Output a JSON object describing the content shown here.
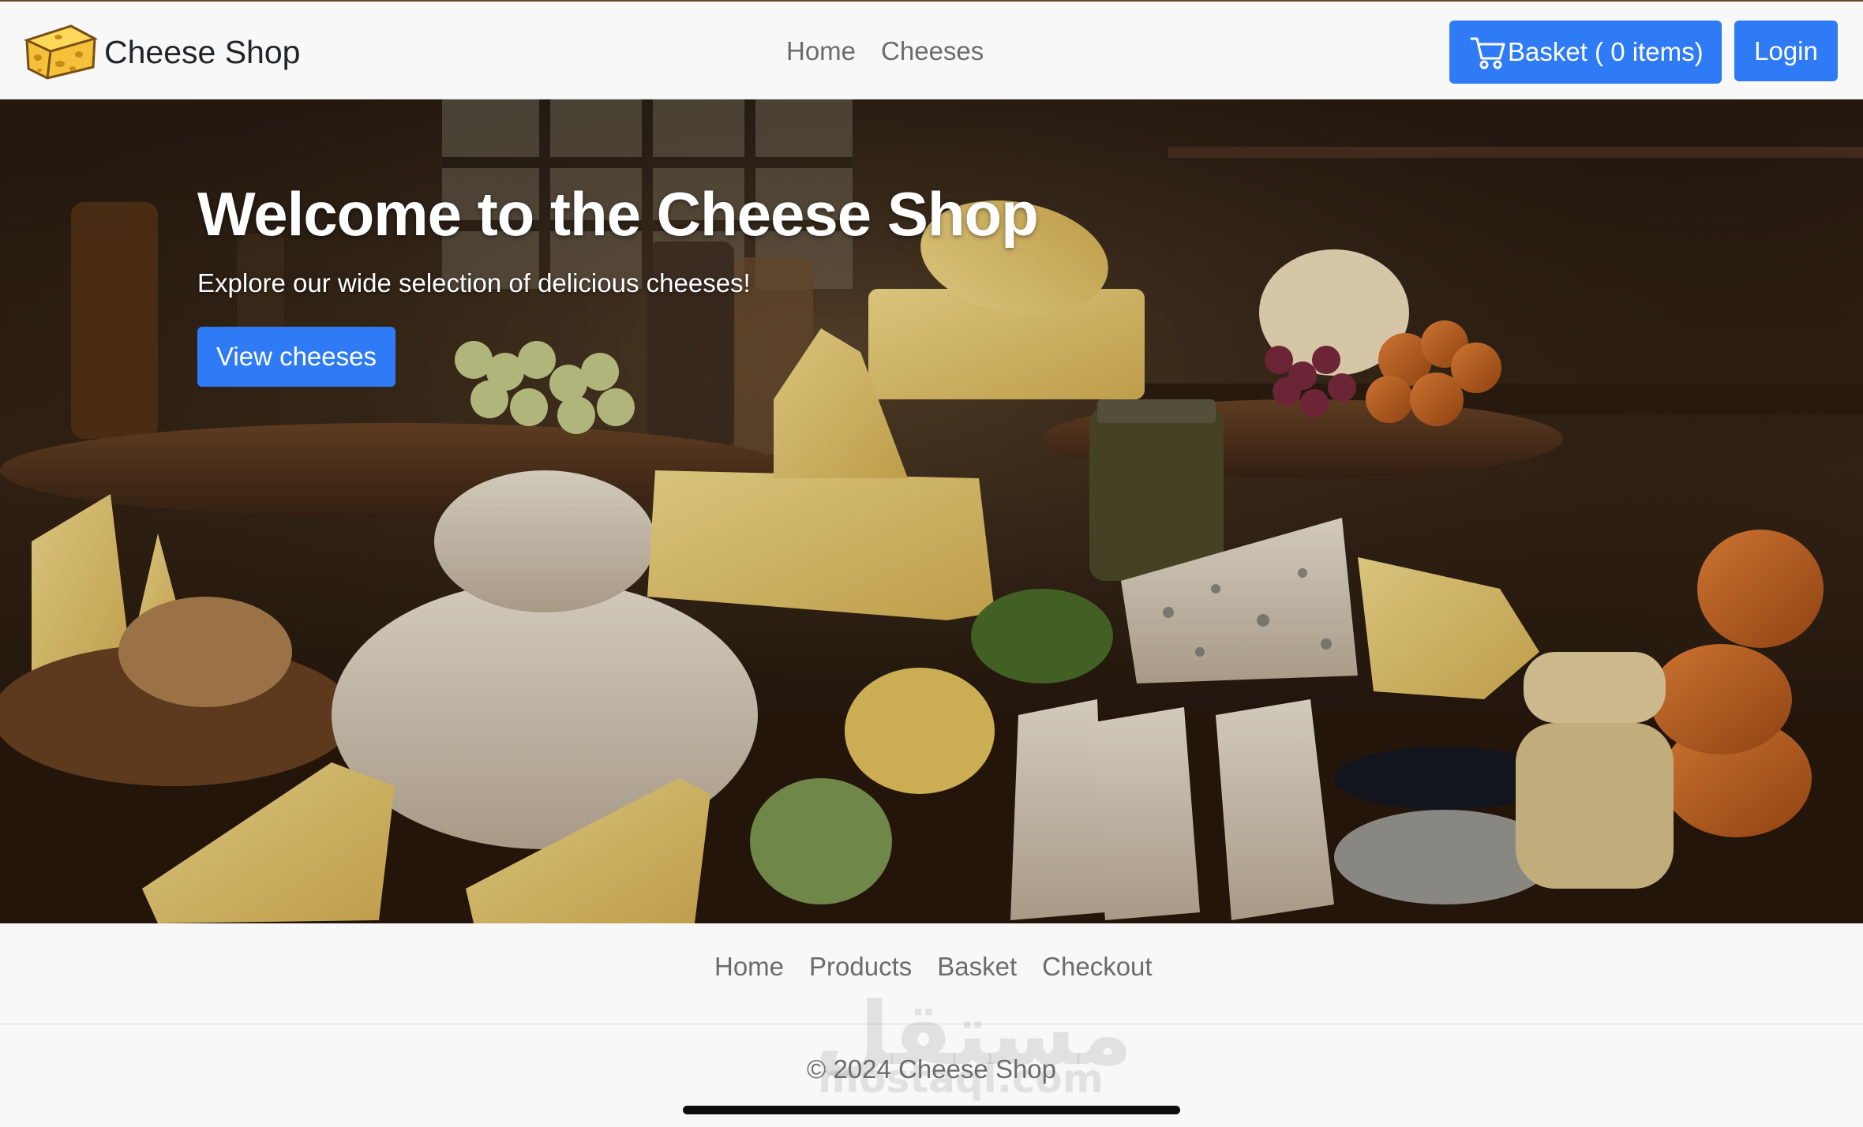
{
  "navbar": {
    "brand": "Cheese Shop",
    "logo_icon": "cheese-wedge-icon",
    "links": [
      "Home",
      "Cheeses"
    ],
    "basket_label": "Basket ( 0 items)",
    "basket_icon": "cart-icon",
    "login_label": "Login"
  },
  "hero": {
    "title": "Welcome to the Cheese Shop",
    "subtitle": "Explore our wide selection of delicious cheeses!",
    "cta_label": "View cheeses",
    "background": "cheese-assortment-photo"
  },
  "footer": {
    "links": [
      "Home",
      "Products",
      "Basket",
      "Checkout"
    ],
    "copyright": "© 2024 Cheese Shop",
    "watermark_ar": "مستقل",
    "watermark_en": "mostaql.com"
  },
  "colors": {
    "primary": "#2f7bf6",
    "nav_text": "#6c6c6c",
    "brand_text": "#212529",
    "page_bg": "#f8f8f8"
  }
}
